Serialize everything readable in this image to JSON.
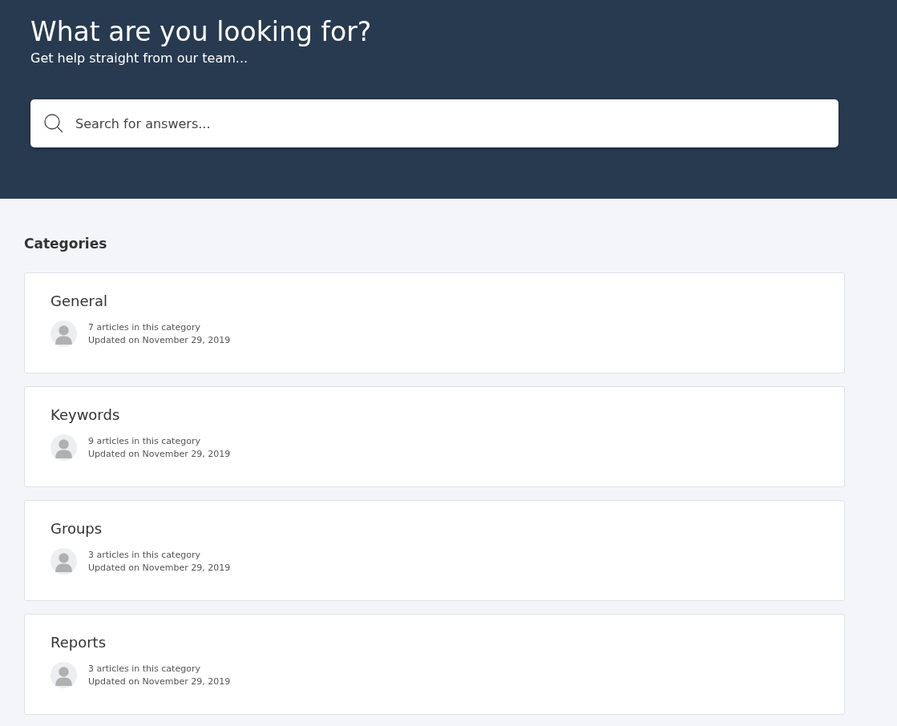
{
  "header": {
    "title": "What are you looking for?",
    "subtitle": "Get help straight from our team...",
    "search": {
      "placeholder": "Search for answers..."
    }
  },
  "categories_heading": "Categories",
  "categories": [
    {
      "name": "General",
      "count": "7 articles in this category",
      "updated": "Updated on November 29, 2019"
    },
    {
      "name": "Keywords",
      "count": "9 articles in this category",
      "updated": "Updated on November 29, 2019"
    },
    {
      "name": "Groups",
      "count": "3 articles in this category",
      "updated": "Updated on November 29, 2019"
    },
    {
      "name": "Reports",
      "count": "3 articles in this category",
      "updated": "Updated on November 29, 2019"
    }
  ]
}
